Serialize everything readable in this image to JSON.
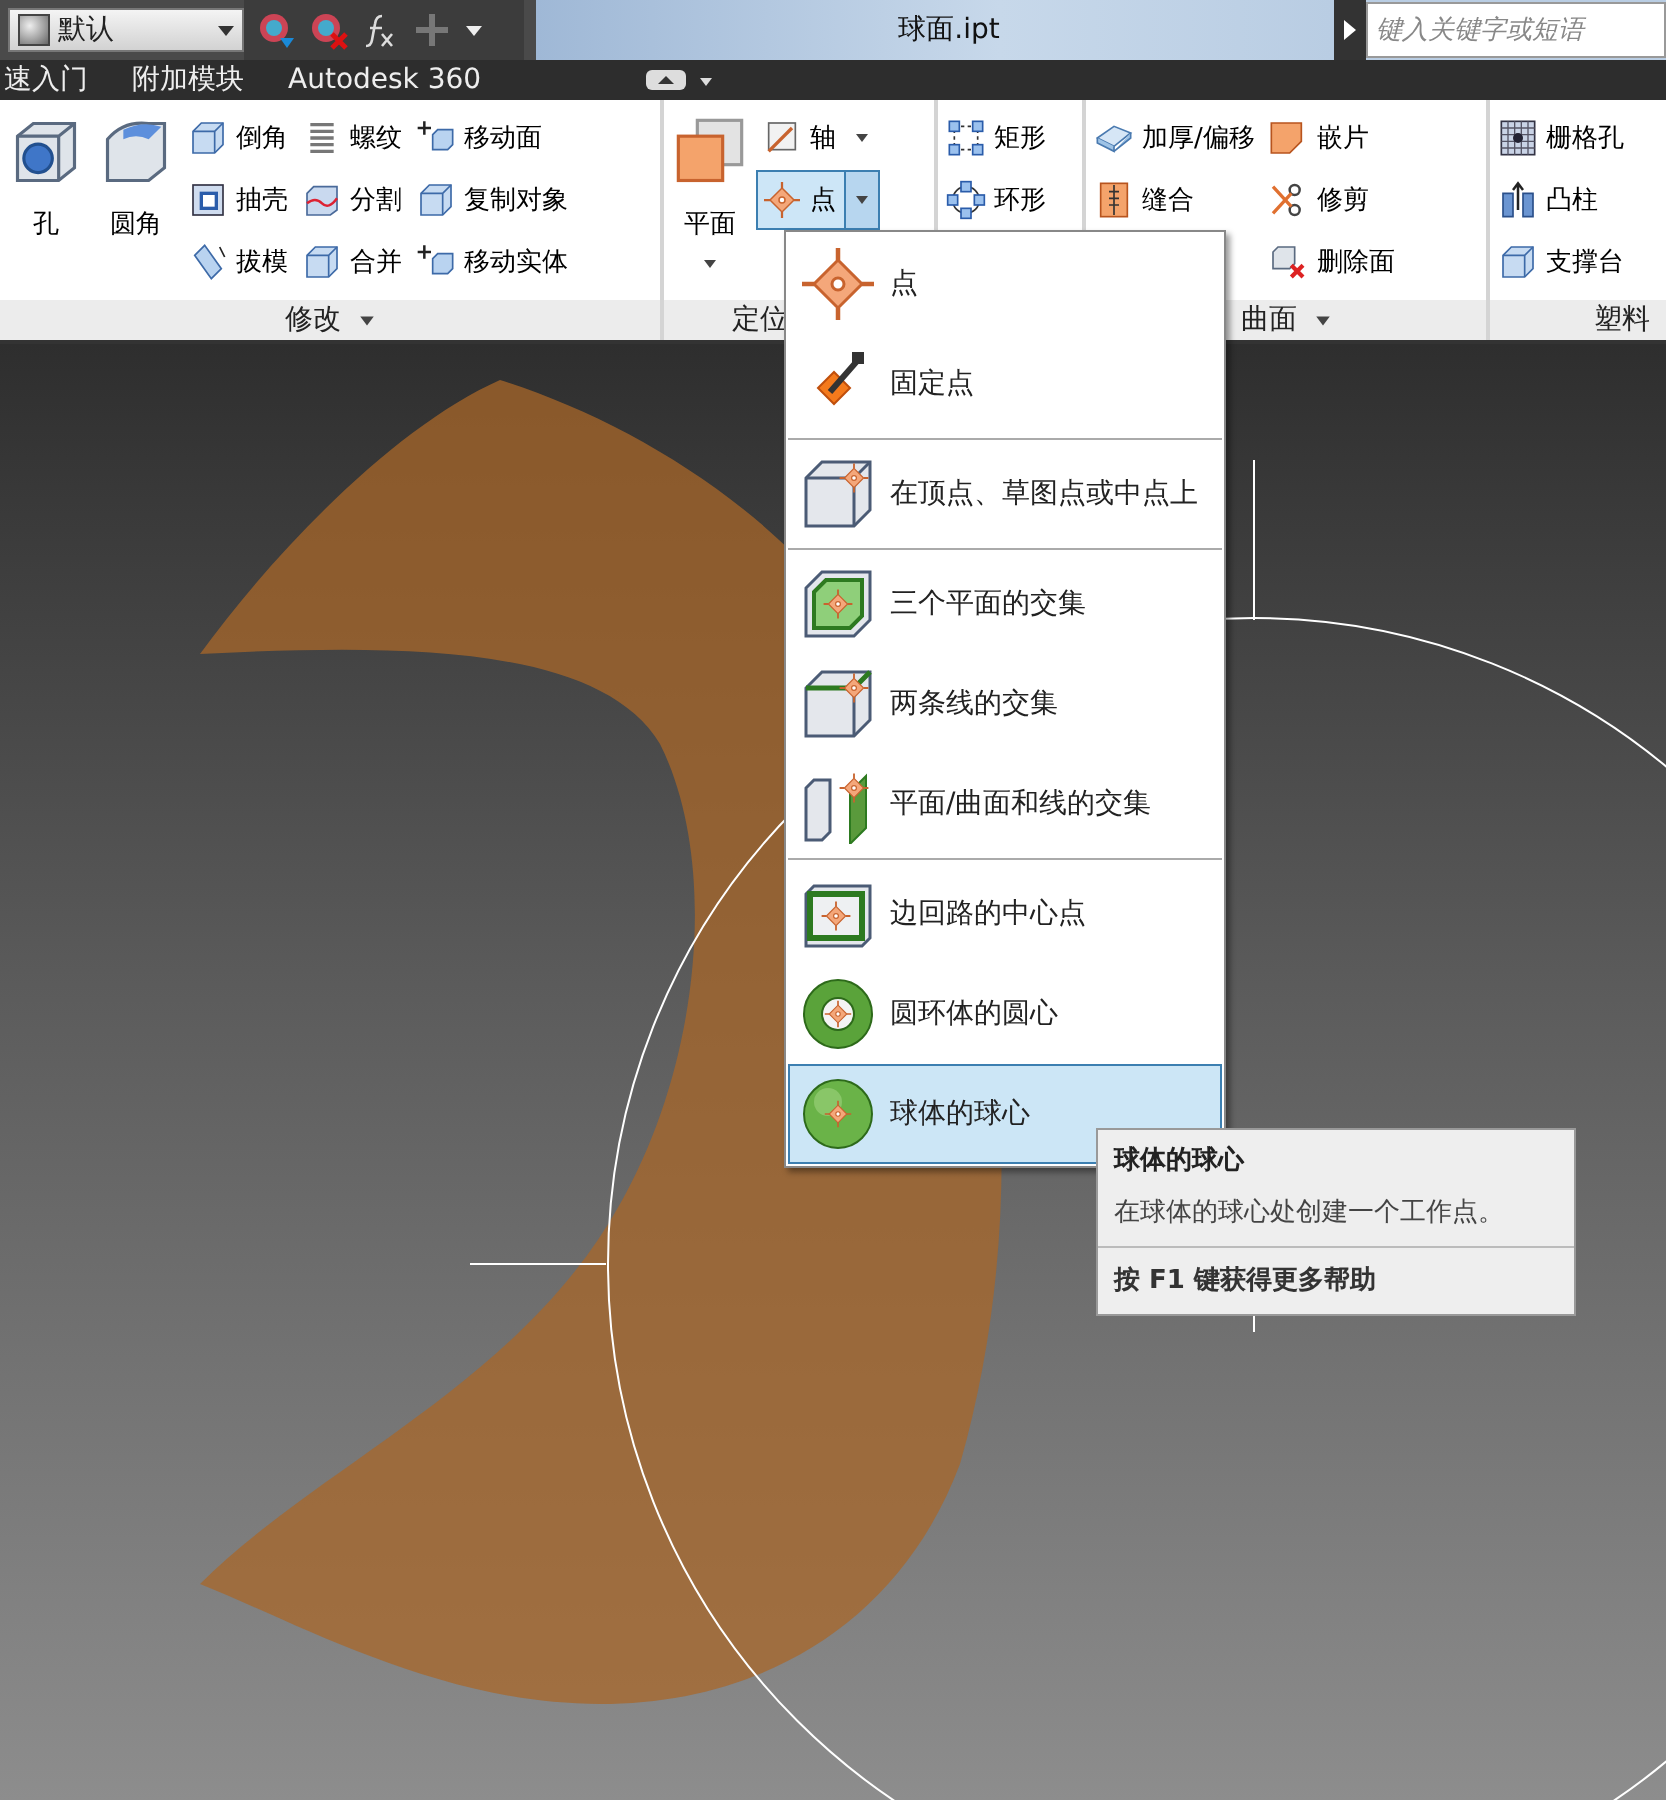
{
  "title_bar": {
    "material": "默认",
    "title": "球面.ipt",
    "search_placeholder": "键入关键字或短语"
  },
  "menu_bar": {
    "items": [
      "速入门",
      "附加模块",
      "Autodesk 360"
    ]
  },
  "ribbon": {
    "panels": [
      {
        "label": "修改",
        "has_menu": true,
        "columns": [
          {
            "kind": "large",
            "buttons": [
              {
                "label": "孔",
                "pressed": false,
                "dropdown": false
              }
            ]
          },
          {
            "kind": "large",
            "buttons": [
              {
                "label": "圆角",
                "pressed": false,
                "dropdown": false
              }
            ]
          },
          {
            "kind": "small",
            "buttons": [
              {
                "label": "倒角",
                "pressed": false,
                "dropdown": false
              },
              {
                "label": "抽壳",
                "pressed": false,
                "dropdown": false
              },
              {
                "label": "拔模",
                "pressed": false,
                "dropdown": false
              }
            ]
          },
          {
            "kind": "small",
            "buttons": [
              {
                "label": "螺纹",
                "pressed": false,
                "dropdown": false
              },
              {
                "label": "分割",
                "pressed": false,
                "dropdown": false
              },
              {
                "label": "合并",
                "pressed": false,
                "dropdown": false
              }
            ]
          },
          {
            "kind": "small",
            "buttons": [
              {
                "label": "移动面",
                "pressed": false,
                "dropdown": false
              },
              {
                "label": "复制对象",
                "pressed": false,
                "dropdown": false
              },
              {
                "label": "移动实体",
                "pressed": false,
                "dropdown": false
              }
            ]
          }
        ]
      },
      {
        "label": "定位",
        "has_menu": false,
        "columns": [
          {
            "kind": "large",
            "buttons": [
              {
                "label": "平面",
                "pressed": false,
                "dropdown": true
              }
            ]
          },
          {
            "kind": "small",
            "buttons": [
              {
                "label": "轴",
                "pressed": false,
                "dropdown": true
              },
              {
                "label": "点",
                "pressed": true,
                "dropdown": true
              }
            ]
          }
        ]
      },
      {
        "columns": [
          {
            "kind": "small",
            "buttons": [
              {
                "label": "矩形",
                "pressed": false,
                "dropdown": false
              },
              {
                "label": "环形",
                "pressed": false,
                "dropdown": false
              }
            ]
          }
        ]
      },
      {
        "label": "曲面",
        "has_menu": true,
        "columns": [
          {
            "kind": "small",
            "buttons": [
              {
                "label": "加厚/偏移",
                "pressed": false,
                "dropdown": false
              },
              {
                "label": "缝合",
                "pressed": false,
                "dropdown": false
              }
            ]
          },
          {
            "kind": "small",
            "buttons": [
              {
                "label": "嵌片",
                "pressed": false,
                "dropdown": false
              },
              {
                "label": "修剪",
                "pressed": false,
                "dropdown": false
              },
              {
                "label": "删除面",
                "pressed": false,
                "dropdown": false
              }
            ]
          }
        ]
      },
      {
        "label": "塑料",
        "has_menu": false,
        "columns": [
          {
            "kind": "small",
            "buttons": [
              {
                "label": "栅格孔",
                "pressed": false,
                "dropdown": false
              },
              {
                "label": "凸柱",
                "pressed": false,
                "dropdown": false
              },
              {
                "label": "支撑台",
                "pressed": false,
                "dropdown": false
              }
            ]
          }
        ]
      }
    ]
  },
  "point_menu": {
    "groups": [
      {
        "items": [
          {
            "label": "点",
            "kind": "point",
            "selected": false
          },
          {
            "label": "固定点",
            "kind": "fixed",
            "selected": false
          }
        ]
      },
      {
        "items": [
          {
            "label": "在顶点、草图点或中点上",
            "kind": "vertex",
            "selected": false
          }
        ]
      },
      {
        "items": [
          {
            "label": "三个平面的交集",
            "kind": "three-planes",
            "selected": false
          },
          {
            "label": "两条线的交集",
            "kind": "two-lines",
            "selected": false
          },
          {
            "label": "平面/曲面和线的交集",
            "kind": "plane-line",
            "selected": false
          }
        ]
      },
      {
        "items": [
          {
            "label": "边回路的中心点",
            "kind": "loop-center",
            "selected": false
          },
          {
            "label": "圆环体的圆心",
            "kind": "torus-center",
            "selected": false
          },
          {
            "label": "球体的球心",
            "kind": "sphere-center",
            "selected": true
          }
        ]
      }
    ]
  },
  "tooltip": {
    "title": "球体的球心",
    "description": "在球体的球心处创建一个工作点。",
    "help": "按 F1 键获得更多帮助"
  }
}
